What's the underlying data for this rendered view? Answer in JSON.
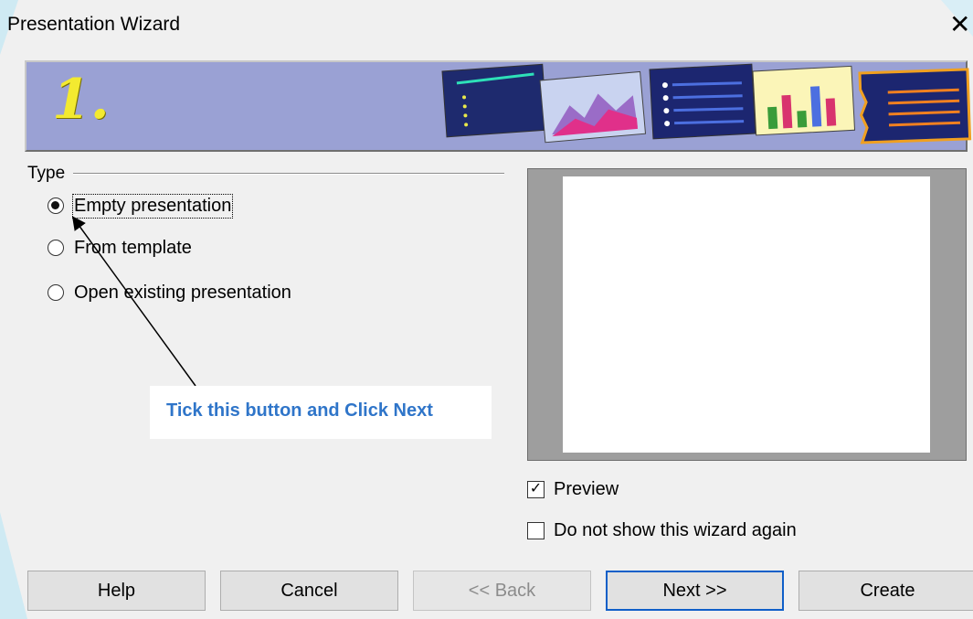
{
  "window": {
    "title": "Presentation Wizard",
    "close_glyph": "✕"
  },
  "banner": {
    "step_number": "1."
  },
  "type_group": {
    "label": "Type",
    "options": [
      {
        "label": "Empty presentation",
        "checked": true
      },
      {
        "label": "From template",
        "checked": false
      },
      {
        "label": "Open existing presentation",
        "checked": false
      }
    ]
  },
  "callout": {
    "text": "Tick this button  and Click Next"
  },
  "preview_checkbox": {
    "label": "Preview",
    "checked": true
  },
  "dont_show_checkbox": {
    "label": "Do not show this wizard again",
    "checked": false
  },
  "buttons": {
    "help": "Help",
    "cancel": "Cancel",
    "back": "<< Back",
    "next": "Next >>",
    "create": "Create"
  },
  "colors": {
    "banner": "#9aa1d4",
    "step_number": "#f3ea30",
    "callout_text": "#2f75c9",
    "default_button_border": "#0f5fc8"
  }
}
